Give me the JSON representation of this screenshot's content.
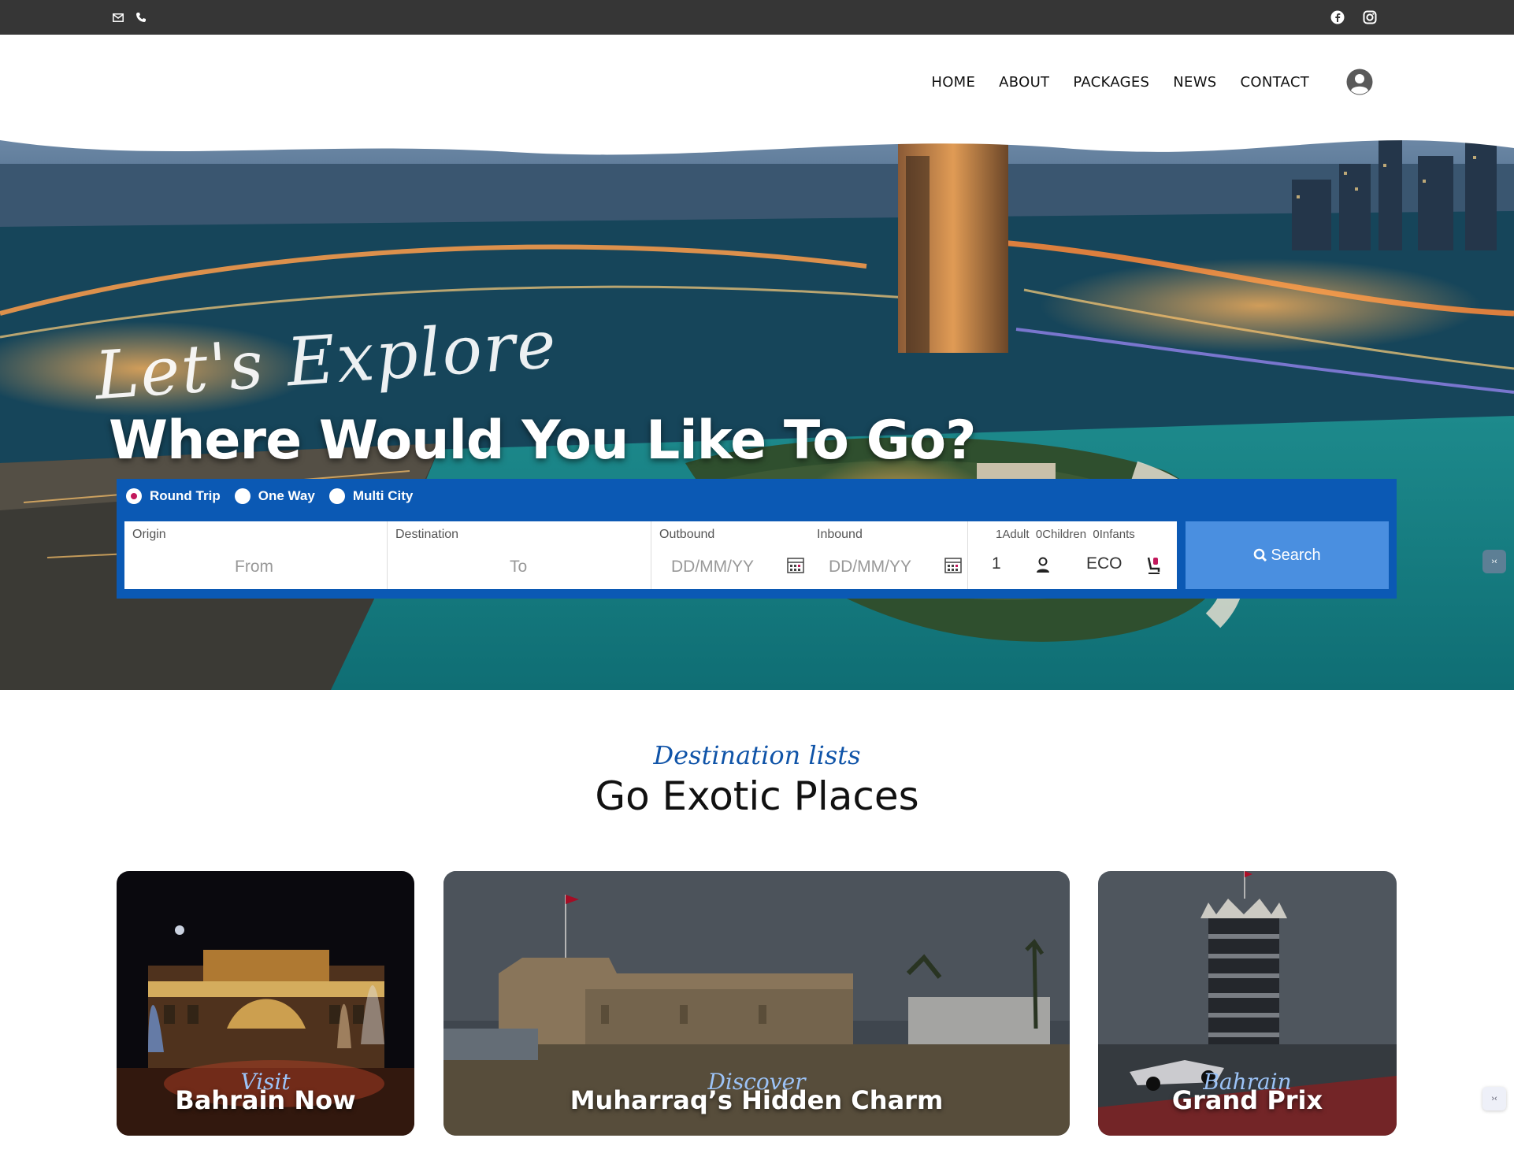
{
  "topbar": {
    "icons": [
      "mail-icon",
      "phone-icon",
      "facebook-icon",
      "instagram-icon"
    ]
  },
  "nav": {
    "links": [
      "HOME",
      "ABOUT",
      "PACKAGES",
      "NEWS",
      "CONTACT"
    ],
    "user_icon": "user-circle-icon"
  },
  "hero": {
    "script": "Let's Explore",
    "title": "Where Would You Like To Go?"
  },
  "search": {
    "trip_types": [
      "Round Trip",
      "One Way",
      "Multi City"
    ],
    "selected_trip": "Round Trip",
    "origin_label": "Origin",
    "origin_placeholder": "From",
    "destination_label": "Destination",
    "destination_placeholder": "To",
    "outbound_label": "Outbound",
    "outbound_placeholder": "DD/MM/YY",
    "inbound_label": "Inbound",
    "inbound_placeholder": "DD/MM/YY",
    "passengers_label": "1Adult  0Children  0Infants",
    "passenger_count": "1",
    "cabin_class": "ECO",
    "button_label": "Search"
  },
  "section": {
    "subtitle": "Destination lists",
    "title": "Go Exotic Places"
  },
  "cards": [
    {
      "script": "Visit",
      "title": "Bahrain Now"
    },
    {
      "script": "Discover",
      "title": "Muharraq’s Hidden Charm"
    },
    {
      "script": "Bahrain",
      "title": "Grand Prix"
    }
  ],
  "colors": {
    "topbar": "#363636",
    "panel": "#0b59b4",
    "search_button": "#4a8fe0",
    "accent_script": "#1054a8"
  }
}
